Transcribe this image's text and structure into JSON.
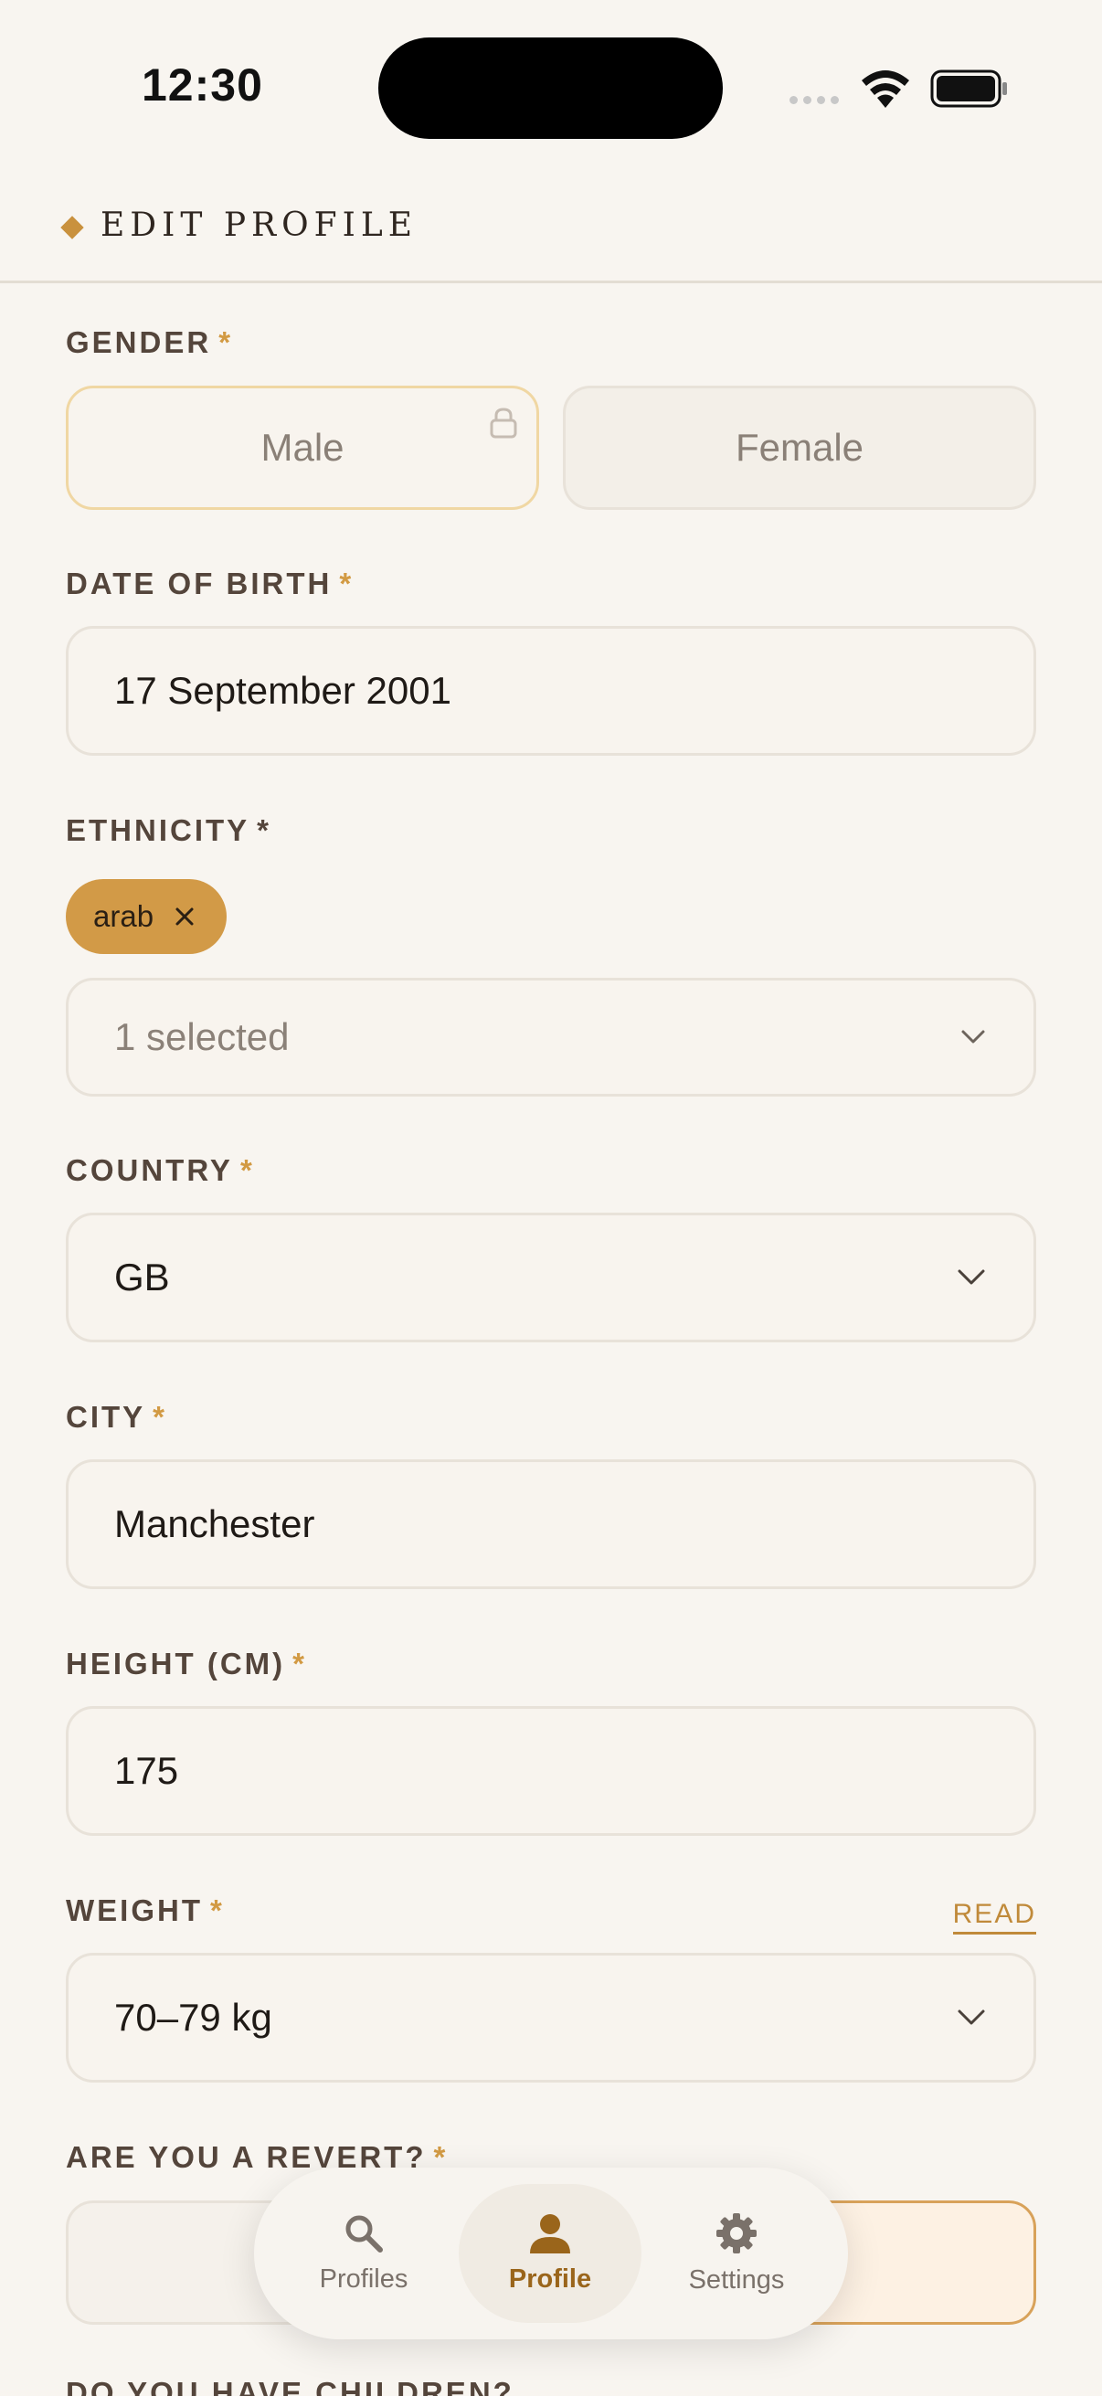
{
  "status": {
    "time": "12:30"
  },
  "header": {
    "title": "EDIT PROFILE"
  },
  "gender": {
    "label": "GENDER",
    "required": "*",
    "options": [
      "Male",
      "Female"
    ],
    "selected": "Male"
  },
  "dob": {
    "label": "DATE OF BIRTH",
    "required": "*",
    "value": "17 September 2001"
  },
  "ethnicity": {
    "label": "ETHNICITY",
    "required": "*",
    "chips": [
      "arab"
    ],
    "summary": "1 selected"
  },
  "country": {
    "label": "COUNTRY",
    "required": "*",
    "value": "GB"
  },
  "city": {
    "label": "CITY",
    "required": "*",
    "value": "Manchester"
  },
  "height": {
    "label": "HEIGHT (CM)",
    "required": "*",
    "value": "175"
  },
  "weight": {
    "label": "WEIGHT",
    "required": "*",
    "value": "70–79 kg",
    "read_link": "READ"
  },
  "revert": {
    "label": "ARE YOU A REVERT?",
    "required": "*"
  },
  "children": {
    "label": "DO YOU HAVE CHILDREN?"
  },
  "nav": {
    "items": [
      {
        "label": "Profiles",
        "icon": "search-icon"
      },
      {
        "label": "Profile",
        "icon": "person-icon",
        "active": true
      },
      {
        "label": "Settings",
        "icon": "gear-icon"
      }
    ]
  },
  "colors": {
    "accent": "#d29a47",
    "background": "#f8f5f0",
    "active_nav": "#9a651b"
  }
}
